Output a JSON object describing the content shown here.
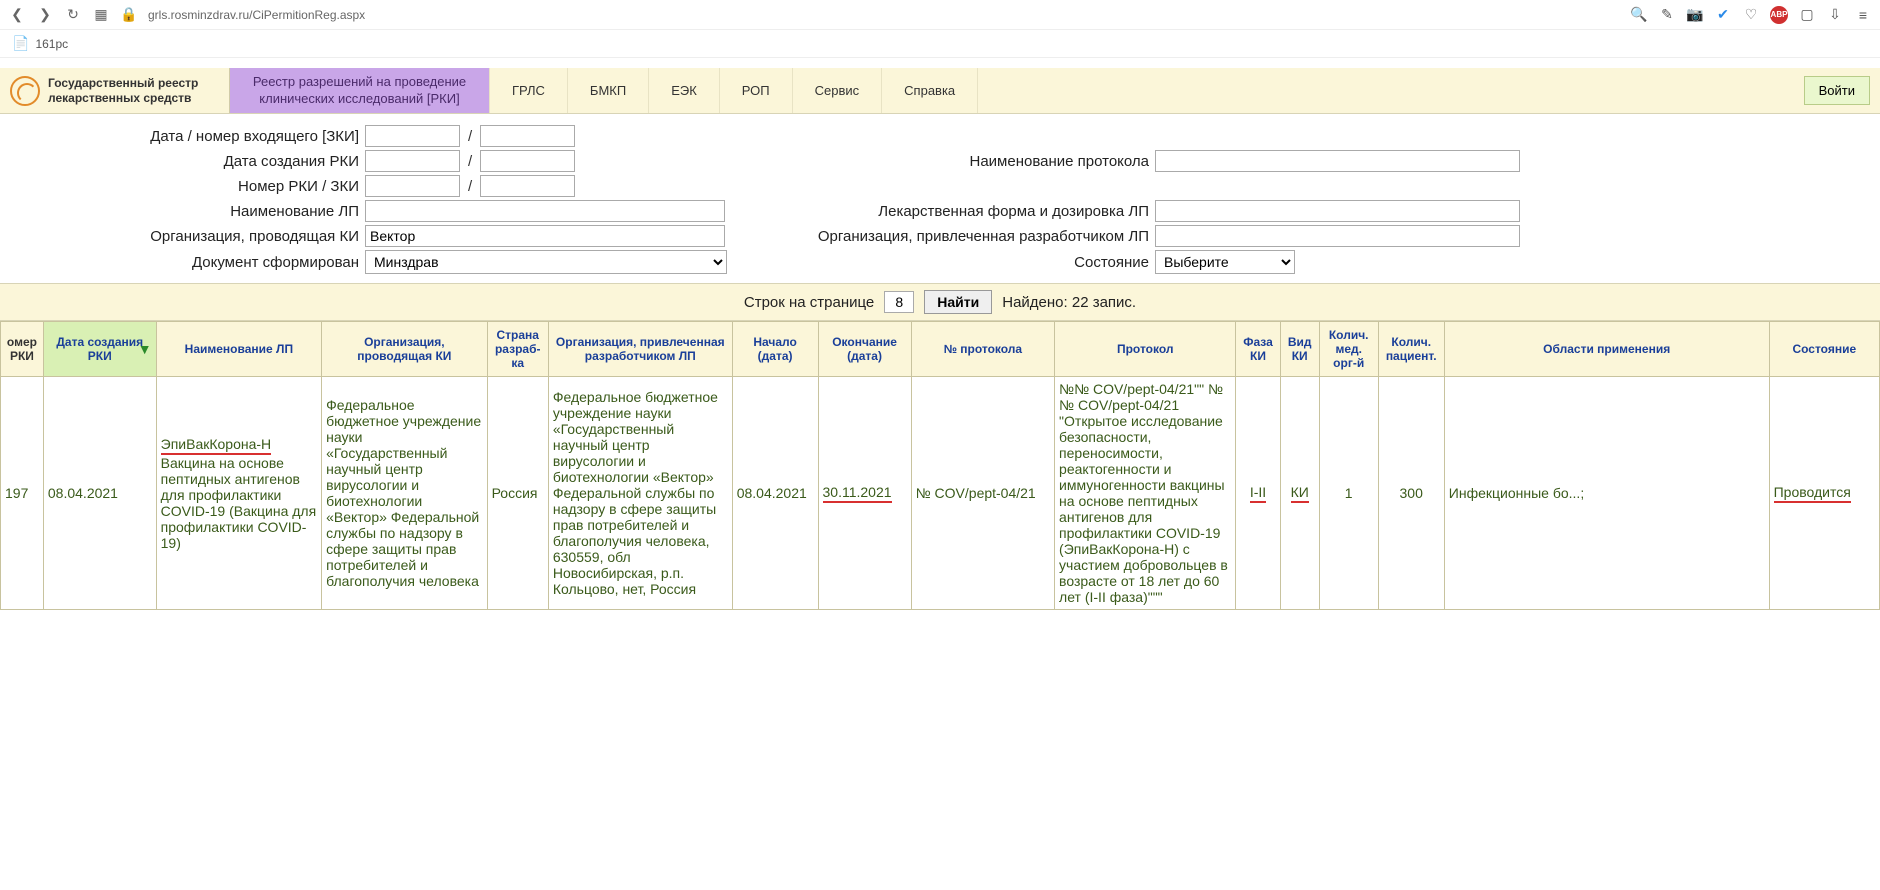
{
  "browser": {
    "url_host": "grls.rosminzdrav.ru",
    "url_path": "/CiPermitionReg.aspx",
    "tab_label": "161рс"
  },
  "nav": {
    "logo_line1": "Государственный реестр",
    "logo_line2": "лекарственных средств",
    "active": "Реестр разрешений на проведение клинических исследований [РКИ]",
    "items": [
      "ГРЛС",
      "БМКП",
      "ЕЭК",
      "РОП",
      "Сервис",
      "Справка"
    ],
    "login": "Войти"
  },
  "filters": {
    "label_incoming": "Дата / номер входящего [ЗКИ]",
    "label_created": "Дата создания РКИ",
    "label_num": "Номер РКИ / ЗКИ",
    "label_lp": "Наименование ЛП",
    "label_org": "Организация, проводящая КИ",
    "label_doc": "Документ сформирован",
    "label_prot_name": "Наименование протокола",
    "label_form": "Лекарственная форма и дозировка ЛП",
    "label_dev_org": "Организация, привлеченная разработчиком ЛП",
    "label_state": "Состояние",
    "org_value": "Вектор",
    "doc_value": "Минздрав",
    "state_value": "Выберите"
  },
  "pager": {
    "rows_label": "Строк на странице",
    "rows_value": "8",
    "find_btn": "Найти",
    "found": "Найдено: 22 запис."
  },
  "columns": {
    "nrki": "омер РКИ",
    "date": "Дата создания РКИ",
    "lp": "Наименование ЛП",
    "org": "Организация, проводящая КИ",
    "country": "Страна разраб-ка",
    "dev": "Организация, привлеченная разработчиком ЛП",
    "start": "Начало (дата)",
    "end": "Окончание (дата)",
    "nprot": "№ протокола",
    "prot": "Протокол",
    "phase": "Фаза КИ",
    "kind": "Вид КИ",
    "orgs": "Колич. мед. орг-й",
    "pat": "Колич. пациент.",
    "area": "Области применения",
    "state": "Состояние"
  },
  "row": {
    "nrki": "197",
    "date": "08.04.2021",
    "lp_name": "ЭпиВакКорона-Н",
    "lp_desc": "Вакцина на основе пептидных антигенов для профилактики COVID-19 (Вакцина для профилактики COVID-19)",
    "org": "Федеральное бюджетное учреждение науки «Государственный научный центр вирусологии и биотехнологии «Вектор» Федеральной службы по надзору в сфере защиты прав потребителей и благополучия человека",
    "country": "Россия",
    "dev": "Федеральное бюджетное учреждение науки «Государственный научный центр вирусологии и биотехнологии «Вектор» Федеральной службы по надзору в сфере защиты прав потребителей и благополучия человека, 630559, обл Новосибирская, р.п. Кольцово, нет, Россия",
    "start": "08.04.2021",
    "end": "30.11.2021",
    "nprot": "№ COV/pept-04/21",
    "prot": "№№ COV/pept-04/21\"\" № № COV/pept-04/21 \"Открытое исследование безопасности, переносимости, реактогенности и иммуногенности вакцины на основе пептидных антигенов для профилактики COVID-19 (ЭпиВакКорона-Н) с участием добровольцев в возрасте от 18 лет до 60 лет (I-II фаза)\"\"\"",
    "phase": "I-II",
    "kind": "КИ",
    "orgs": "1",
    "pat": "300",
    "area": "Инфекционные бо...;",
    "state": "Проводится"
  }
}
